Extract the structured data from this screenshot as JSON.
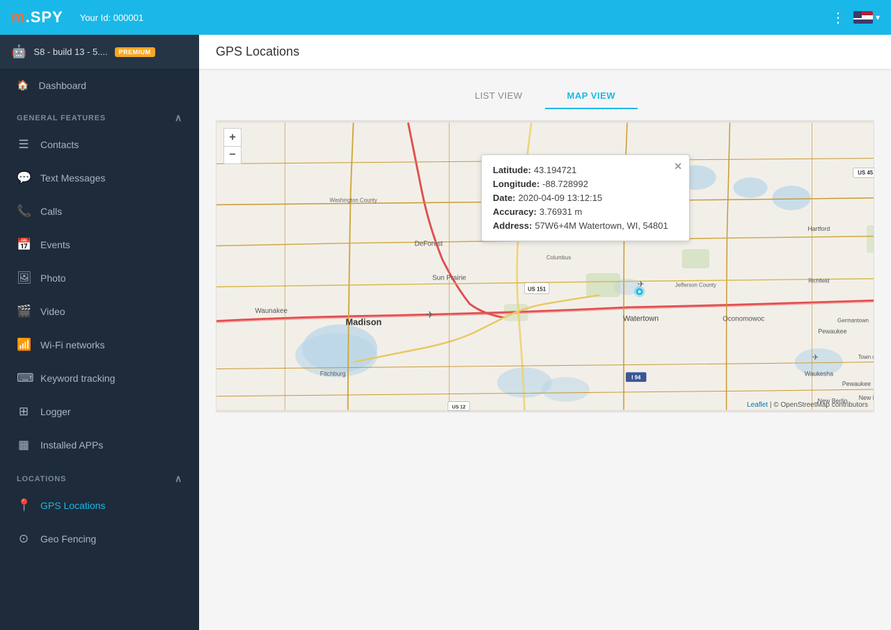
{
  "header": {
    "logo": "mSPY",
    "user_id_label": "Your Id: 000001",
    "page_title": "GPS Locations"
  },
  "device": {
    "name": "S8 - build 13 - 5....",
    "badge": "PREMIUM"
  },
  "sidebar": {
    "dashboard_label": "Dashboard",
    "general_features_label": "GENERAL FEATURES",
    "locations_label": "LOCATIONS",
    "items": [
      {
        "id": "contacts",
        "label": "Contacts",
        "icon": "👤"
      },
      {
        "id": "text-messages",
        "label": "Text Messages",
        "icon": "💬"
      },
      {
        "id": "calls",
        "label": "Calls",
        "icon": "📞"
      },
      {
        "id": "events",
        "label": "Events",
        "icon": "📅"
      },
      {
        "id": "photo",
        "label": "Photo",
        "icon": "🖼"
      },
      {
        "id": "video",
        "label": "Video",
        "icon": "🎬"
      },
      {
        "id": "wifi",
        "label": "Wi-Fi networks",
        "icon": "📶"
      },
      {
        "id": "keyword",
        "label": "Keyword tracking",
        "icon": "⌨"
      },
      {
        "id": "logger",
        "label": "Logger",
        "icon": "⌨"
      },
      {
        "id": "installed-apps",
        "label": "Installed APPs",
        "icon": "▦"
      }
    ],
    "locations_items": [
      {
        "id": "gps",
        "label": "GPS Locations",
        "icon": "📍",
        "active": true
      },
      {
        "id": "geofencing",
        "label": "Geo Fencing",
        "icon": "⊙"
      }
    ]
  },
  "tabs": [
    {
      "id": "list-view",
      "label": "LIST VIEW",
      "active": false
    },
    {
      "id": "map-view",
      "label": "MAP VIEW",
      "active": true
    }
  ],
  "popup": {
    "latitude_label": "Latitude:",
    "latitude_value": "43.194721",
    "longitude_label": "Longitude:",
    "longitude_value": "-88.728992",
    "date_label": "Date:",
    "date_value": "2020-04-09 13:12:15",
    "accuracy_label": "Accuracy:",
    "accuracy_value": "3.76931 m",
    "address_label": "Address:",
    "address_value": "57W6+4M Watertown, WI, 54801"
  },
  "map": {
    "attribution_leaflet": "Leaflet",
    "attribution_osm": "© OpenStreetMap contributors",
    "zoom_in": "+",
    "zoom_out": "−"
  }
}
